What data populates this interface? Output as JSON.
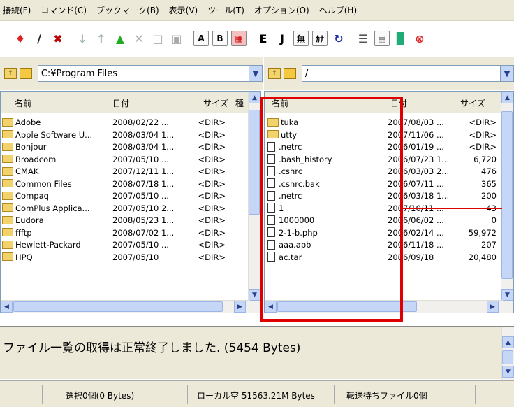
{
  "menu": [
    "接続(F)",
    "コマンド(C)",
    "ブックマーク(B)",
    "表示(V)",
    "ツール(T)",
    "オプション(O)",
    "ヘルプ(H)"
  ],
  "toolbar": {
    "icons": [
      "connect-icon",
      "quick-connect-icon",
      "disconnect-icon",
      "download-icon",
      "upload-icon",
      "parent-folder-icon",
      "delete-icon",
      "rename-icon",
      "mkdir-icon",
      "ascii-mode-icon",
      "binary-mode-icon",
      "auto-mode-icon",
      "euc-icon",
      "jis-icon",
      "no-conversion-icon",
      "kana-icon",
      "refresh-icon",
      "list-view-icon",
      "detail-view-icon",
      "tree-icon",
      "stop-icon"
    ],
    "labels": {
      "ascii": "A",
      "binary": "B",
      "euc": "E",
      "jis": "J",
      "noconv": "無",
      "kana": "ｶﾅ"
    }
  },
  "local": {
    "path": "C:¥Program Files",
    "columns": [
      "名前",
      "日付",
      "サイズ",
      "種"
    ],
    "rows": [
      {
        "name": "Adobe",
        "date": "2008/02/22 ...",
        "size": "<DIR>",
        "type": "folder"
      },
      {
        "name": "Apple Software U...",
        "date": "2008/03/04 1...",
        "size": "<DIR>",
        "type": "folder"
      },
      {
        "name": "Bonjour",
        "date": "2008/03/04 1...",
        "size": "<DIR>",
        "type": "folder"
      },
      {
        "name": "Broadcom",
        "date": "2007/05/10 ...",
        "size": "<DIR>",
        "type": "folder"
      },
      {
        "name": "CMAK",
        "date": "2007/12/11 1...",
        "size": "<DIR>",
        "type": "folder"
      },
      {
        "name": "Common Files",
        "date": "2008/07/18 1...",
        "size": "<DIR>",
        "type": "folder"
      },
      {
        "name": "Compaq",
        "date": "2007/05/10 ...",
        "size": "<DIR>",
        "type": "folder"
      },
      {
        "name": "ComPlus Applica...",
        "date": "2007/05/10 2...",
        "size": "<DIR>",
        "type": "folder"
      },
      {
        "name": "Eudora",
        "date": "2008/05/23 1...",
        "size": "<DIR>",
        "type": "folder"
      },
      {
        "name": "ffftp",
        "date": "2008/07/02 1...",
        "size": "<DIR>",
        "type": "folder"
      },
      {
        "name": "Hewlett-Packard",
        "date": "2007/05/10 ...",
        "size": "<DIR>",
        "type": "folder"
      },
      {
        "name": "HPQ",
        "date": "2007/05/10",
        "size": "<DIR>",
        "type": "folder"
      }
    ]
  },
  "remote": {
    "path": "/",
    "columns": [
      "名前",
      "日付",
      "サイズ"
    ],
    "rows": [
      {
        "name": "tuka",
        "date": "2007/08/03 ...",
        "size": "<DIR>",
        "type": "folder"
      },
      {
        "name": "utty",
        "date": "2007/11/06 ...",
        "size": "<DIR>",
        "type": "folder"
      },
      {
        "name": ".netrc",
        "date": "2006/01/19 ...",
        "size": "<DIR>",
        "type": "file"
      },
      {
        "name": ".bash_history",
        "date": "2006/07/23 1...",
        "size": "6,720",
        "type": "file"
      },
      {
        "name": ".cshrc",
        "date": "2006/03/03 2...",
        "size": "476",
        "type": "file"
      },
      {
        "name": ".cshrc.bak",
        "date": "2006/07/11 ...",
        "size": "365",
        "type": "file"
      },
      {
        "name": ".netrc",
        "date": "2006/03/18 1...",
        "size": "200",
        "type": "file"
      },
      {
        "name": "1",
        "date": "2007/10/11 ...",
        "size": "43",
        "type": "file"
      },
      {
        "name": "1000000",
        "date": "2006/06/02 ...",
        "size": "0",
        "type": "file"
      },
      {
        "name": "2-1-b.php",
        "date": "2006/02/14 ...",
        "size": "59,972",
        "type": "file"
      },
      {
        "name": "aaa.apb",
        "date": "2006/11/18 ...",
        "size": "207",
        "type": "file"
      },
      {
        "name": "ac.tar",
        "date": "2006/09/18",
        "size": "20,480",
        "type": "file"
      }
    ]
  },
  "log": {
    "message": "ファイル一覧の取得は正常終了しました. (5454 Bytes)"
  },
  "status": {
    "selection": "選択0個(0 Bytes)",
    "local_free": "ローカル空 51563.21M Bytes",
    "queue": "転送待ちファイル0個"
  },
  "colors": {
    "highlight": "#e00000",
    "chrome": "#ece9d8",
    "scroll": "#c6d6f7"
  }
}
